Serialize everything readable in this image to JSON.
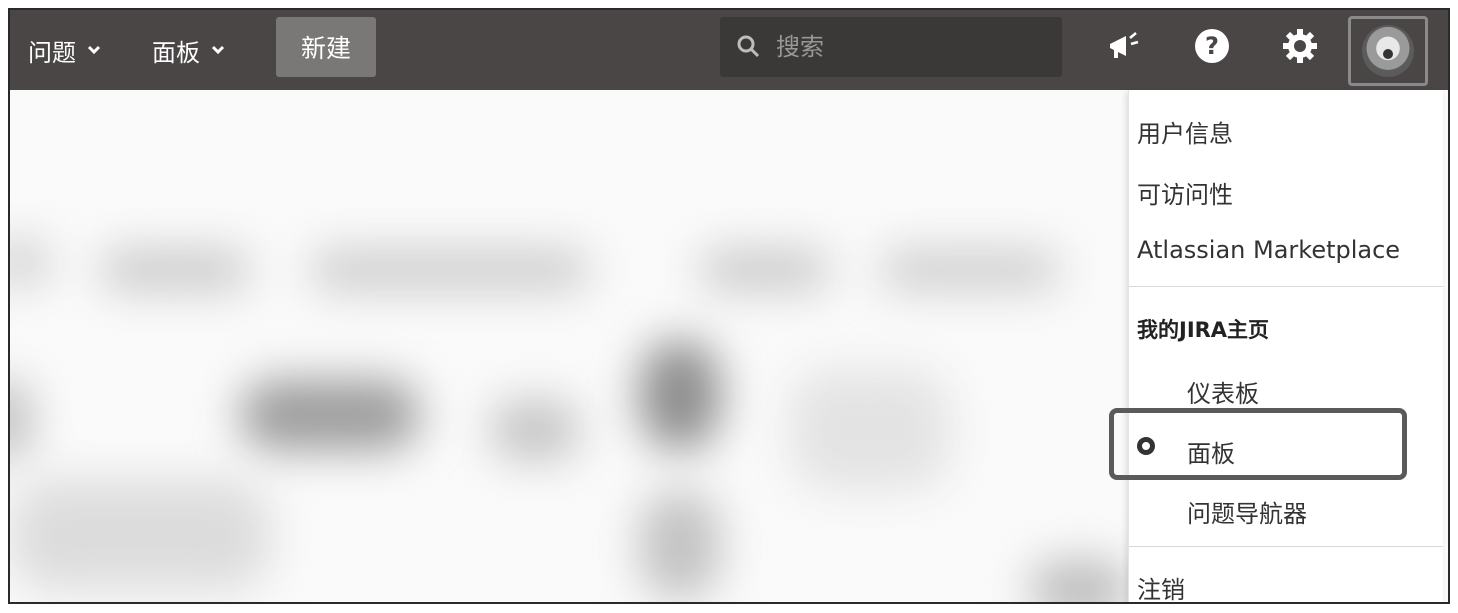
{
  "nav": {
    "issues_label": "问题",
    "boards_label": "面板",
    "create_label": "新建"
  },
  "search": {
    "placeholder": "搜索"
  },
  "icons": {
    "announce": "megaphone-icon",
    "help": "help-icon",
    "settings": "gear-icon",
    "avatar": "avatar"
  },
  "user_menu": {
    "profile": "用户信息",
    "accessibility": "可访问性",
    "marketplace": "Atlassian Marketplace",
    "home_heading": "我的JIRA主页",
    "dashboard": "仪表板",
    "boards": "面板",
    "issue_navigator": "问题导航器",
    "logout": "注销",
    "selected_item": "面板"
  },
  "colors": {
    "topbar": "#4a4646",
    "create_button": "#7a7777",
    "dropdown_bg": "#ffffff",
    "highlight_border": "#5a5a5a"
  }
}
